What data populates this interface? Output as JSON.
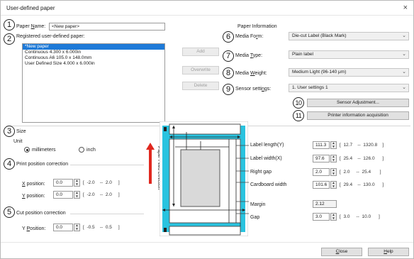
{
  "window": {
    "title": "User-defined paper",
    "close_glyph": "×"
  },
  "markers": [
    "1",
    "2",
    "3",
    "4",
    "5",
    "6",
    "7",
    "8",
    "9",
    "10",
    "11"
  ],
  "paper_name": {
    "label_pre": "Paper ",
    "label_u": "N",
    "label_post": "ame:",
    "value": "<New paper>"
  },
  "registered": {
    "label": "Registered user-defined paper:",
    "items": [
      "*New paper",
      "Continuous 4.300 x 6.000in",
      "Continuous A6 105.0 x 148.0mm",
      "User Defined Size 4.000 x 6.000in"
    ]
  },
  "list_buttons": {
    "add": "Add",
    "overwrite": "Overwrite",
    "delete": "Delete"
  },
  "paper_info": {
    "heading": "Paper Information",
    "media_form": {
      "label_pre": "Media Fo",
      "label_u": "r",
      "label_post": "m:",
      "value": "Die-cut Label (Black Mark)"
    },
    "media_type": {
      "label_pre": "Media ",
      "label_u": "T",
      "label_post": "ype:",
      "value": "Plain label"
    },
    "media_weight": {
      "label_pre": "Media ",
      "label_u": "W",
      "label_post": "eight:",
      "value": "Medium Light (96-140 μm)"
    },
    "sensor_settings": {
      "label_pre": "Sensor setti",
      "label_u": "n",
      "label_post": "gs:",
      "value": "1. User settings 1"
    },
    "sensor_adjustment_button": "Sensor Adjustment...",
    "printer_info_button": "Printer information acquisition"
  },
  "size": {
    "heading": "Size",
    "unit_label": "Unit",
    "millimeters": "millimeters",
    "inch": "inch",
    "selected_unit": "millimeters"
  },
  "print_position": {
    "heading": "Print position correction",
    "x": {
      "label_u": "X",
      "label_post": " position:",
      "value": "0.0",
      "range_open": "[",
      "min": "-2.0",
      "sep": "--",
      "max": "2.0",
      "range_close": "]"
    },
    "y": {
      "label_u": "Y",
      "label_post": " position:",
      "value": "0.0",
      "range_open": "[",
      "min": "-2.0",
      "sep": "--",
      "max": "2.0",
      "range_close": "]"
    }
  },
  "cut_position": {
    "heading": "Cut position correction",
    "y": {
      "label_pre": "Y ",
      "label_u": "P",
      "label_post": "osition:",
      "value": "0.0",
      "range_open": "[",
      "min": "-0.5",
      "sep": "--",
      "max": "0.5",
      "range_close": "]"
    }
  },
  "feed_direction_text": "Paper Feed Direction",
  "dimensions": {
    "label_length": {
      "label": "Label length(Y)",
      "value": "111.3",
      "range_open": "[",
      "min": "12.7",
      "sep": "--",
      "max": "1320.8",
      "range_close": "]"
    },
    "label_width": {
      "label": "Label width(X)",
      "value": "97.6",
      "range_open": "[",
      "min": "25.4",
      "sep": "--",
      "max": "126.0",
      "range_close": "]"
    },
    "right_gap": {
      "label": "Right gap",
      "value": "2.0",
      "range_open": "[",
      "min": "2.0",
      "sep": "--",
      "max": "25.4",
      "range_close": "]"
    },
    "cardboard_width": {
      "label": "Cardboard width",
      "value": "101.6",
      "range_open": "[",
      "min": "29.4",
      "sep": "--",
      "max": "130.0",
      "range_close": "]"
    },
    "margin": {
      "label": "Margin",
      "value": "2.12"
    },
    "gap": {
      "label": "Gap",
      "value": "3.0",
      "range_open": "[",
      "min": "3.0",
      "sep": "--",
      "max": "10.0",
      "range_close": "]"
    }
  },
  "footer": {
    "close": "Close",
    "close_u": "C",
    "close_rest": "lose",
    "help_u": "H",
    "help_rest": "elp"
  },
  "colors": {
    "selection": "#1e7ad8",
    "diagram_cyan": "#29c3df",
    "arrow_red": "#e0281f"
  }
}
